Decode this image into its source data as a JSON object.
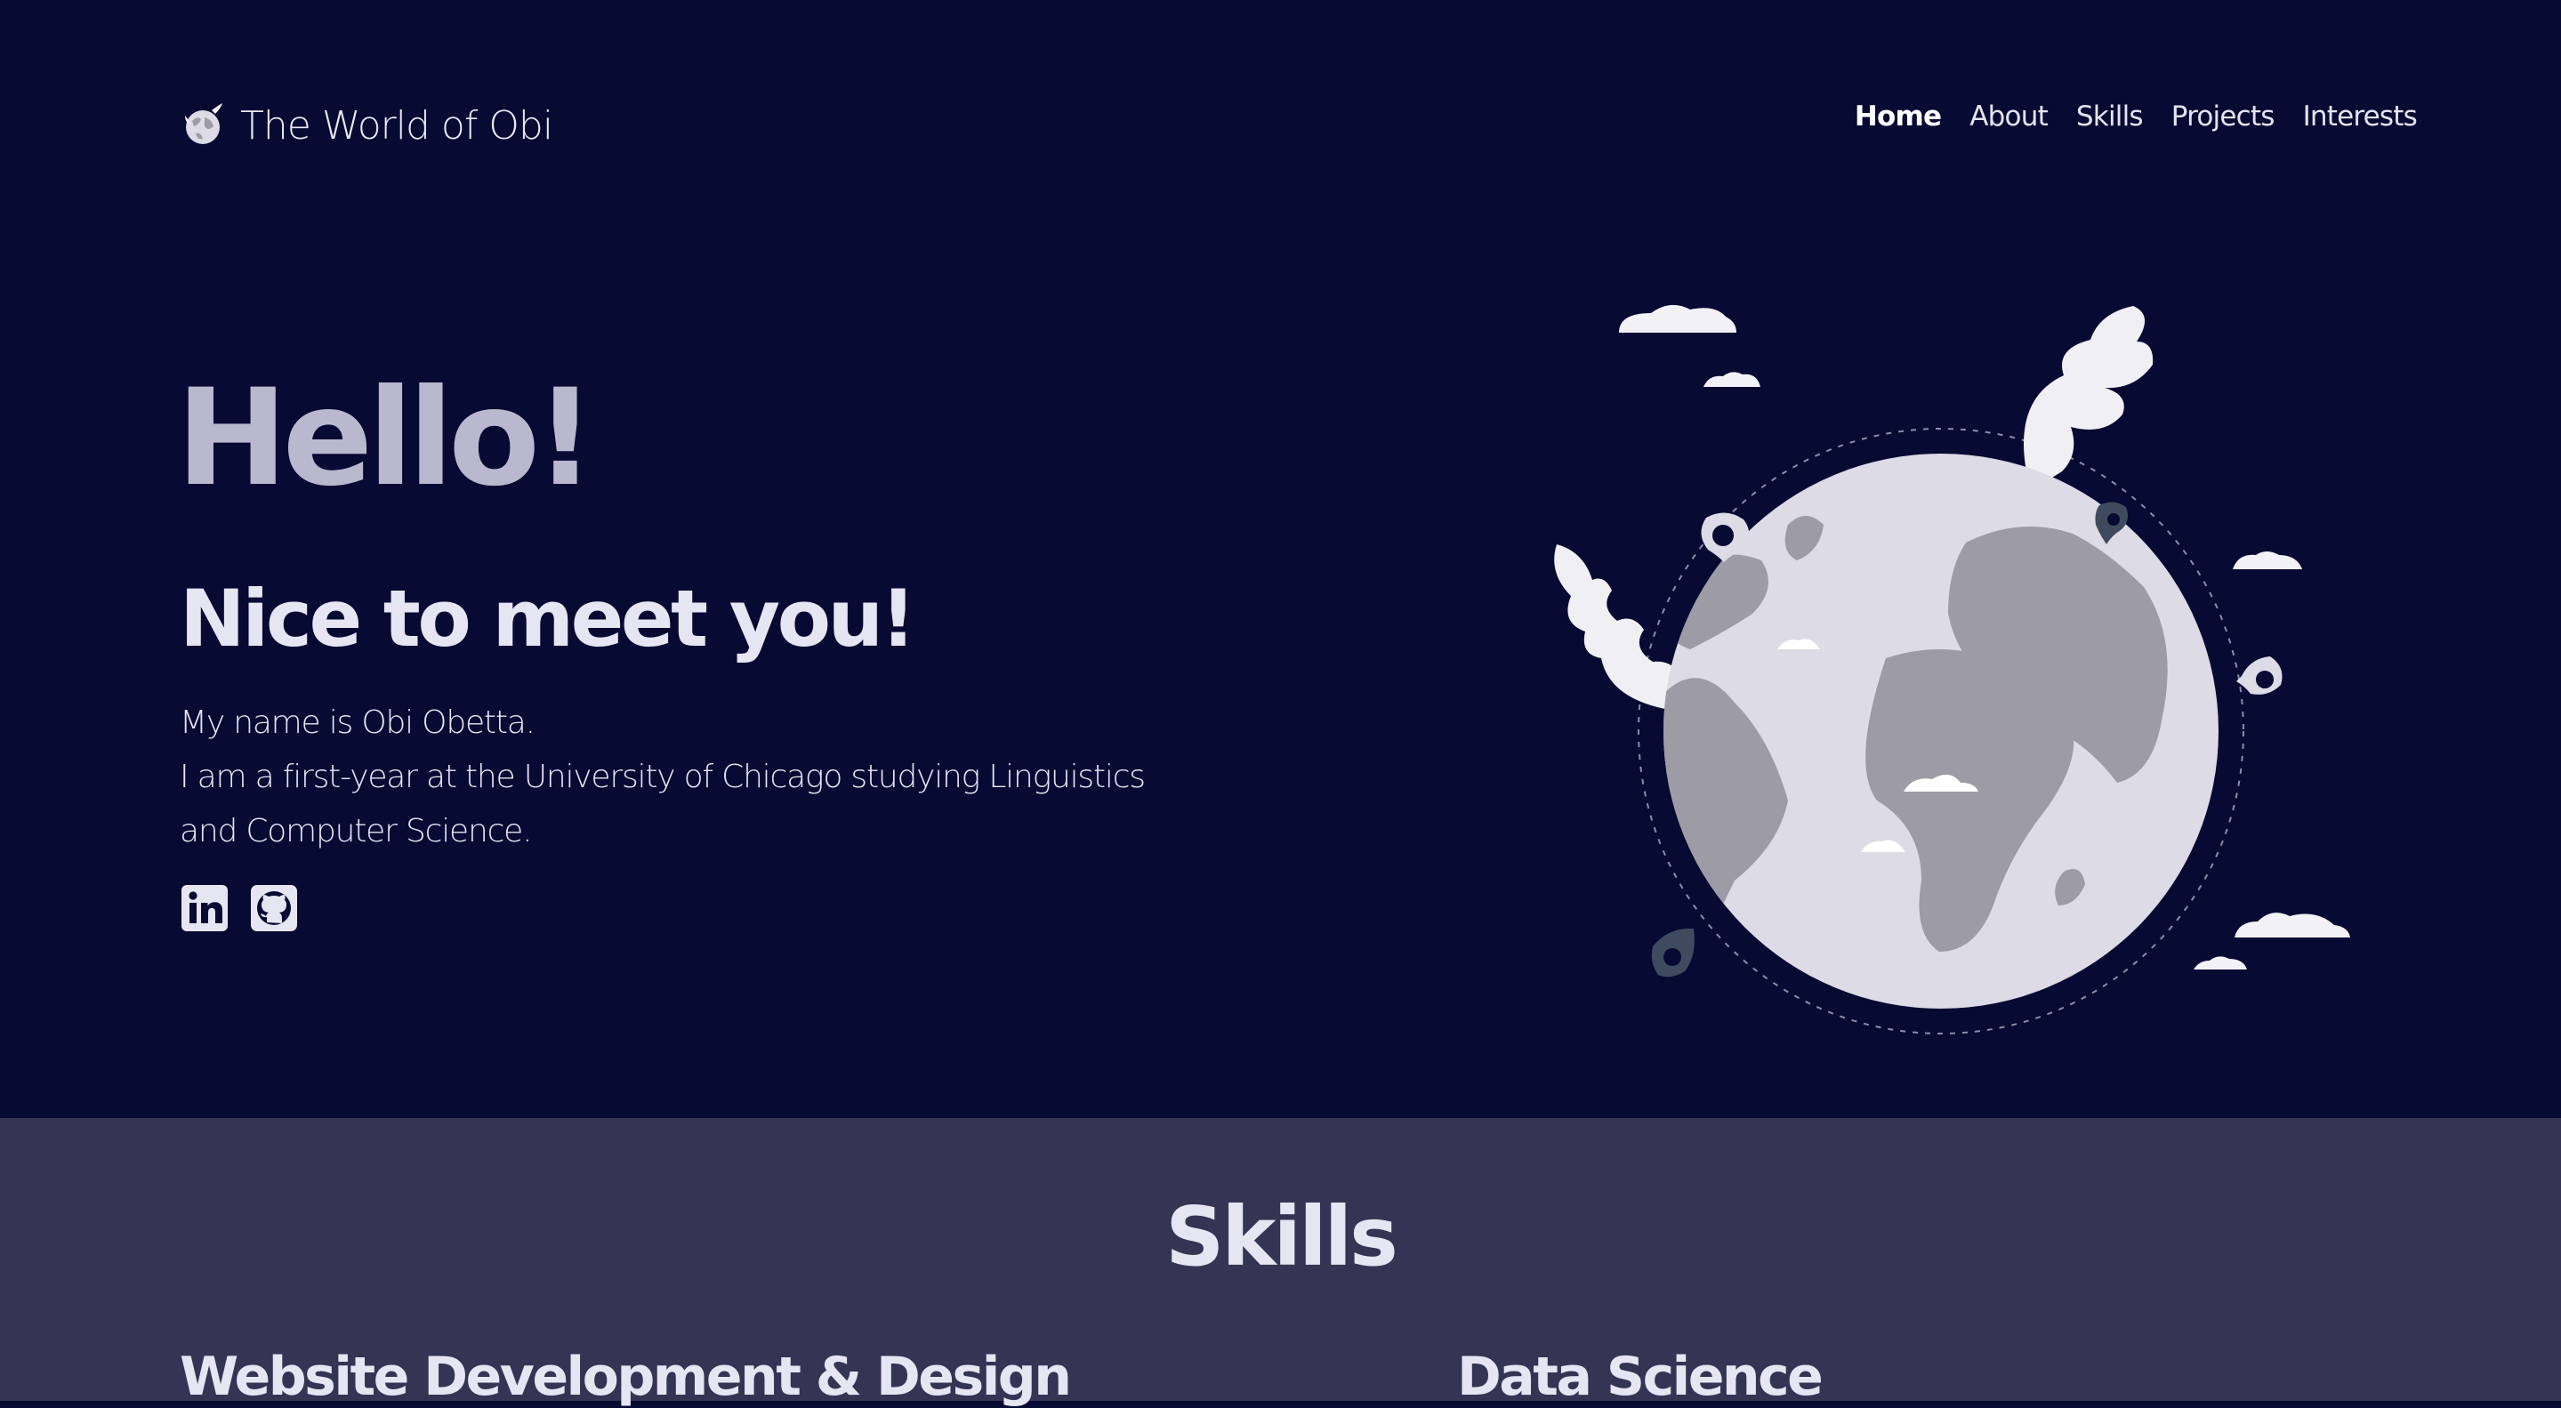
{
  "navbar": {
    "brand": "The World of Obi",
    "items": [
      {
        "label": "Home",
        "active": true
      },
      {
        "label": "About",
        "active": false
      },
      {
        "label": "Skills",
        "active": false
      },
      {
        "label": "Projects",
        "active": false
      },
      {
        "label": "Interests",
        "active": false
      }
    ]
  },
  "hero": {
    "greeting": "Hello!",
    "subheading": "Nice to meet you!",
    "intro_line1": "My name is Obi Obetta.",
    "intro_line2": "I am a first-year at the University of Chicago studying Linguistics and Computer Science.",
    "socials": [
      {
        "icon": "linkedin-icon"
      },
      {
        "icon": "github-icon"
      }
    ]
  },
  "skills": {
    "title": "Skills",
    "categories": [
      "Website Development & Design",
      "Data Science"
    ]
  },
  "colors": {
    "hero_bg": "#070a33",
    "skills_bg": "#343454",
    "greeting": "#b9b8cf",
    "text": "#e6e5f2",
    "globe_land": "#9d9ca6",
    "globe_ocean": "#dcdbe6"
  }
}
